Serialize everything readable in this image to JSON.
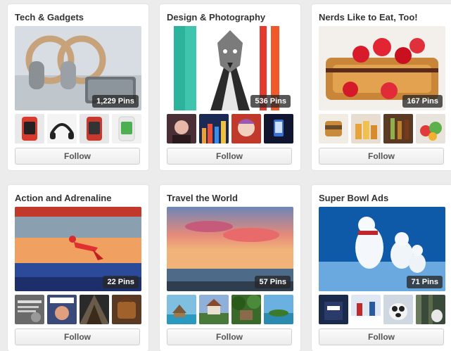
{
  "boards": [
    {
      "title": "Tech & Gadgets",
      "cover_label": "headphones-and-speaker-cover",
      "pin_count": "1,229 Pins",
      "follow_label": "Follow",
      "thumbs": [
        "smartwatch-red",
        "headphones-black",
        "smartwatch-green",
        "smartwatch-white"
      ]
    },
    {
      "title": "Design & Photography",
      "cover_label": "wolf-in-suit-illustration-cover",
      "pin_count": "536 Pins",
      "follow_label": "Follow",
      "thumbs": [
        "portrait-dark",
        "city-skyline-night",
        "woman-portrait-red",
        "hand-holding-phone"
      ]
    },
    {
      "title": "Nerds Like to Eat, Too!",
      "cover_label": "french-toast-strawberries-cover",
      "pin_count": "167 Pins",
      "follow_label": "Follow",
      "thumbs": [
        "food-tin",
        "drinks-glasses",
        "beer-bottles",
        "fruit-plate"
      ]
    },
    {
      "title": "Action and Adrenaline",
      "cover_label": "speed-skater-cover",
      "pin_count": "22 Pins",
      "follow_label": "Follow",
      "thumbs": [
        "quote-poster",
        "magazine-cover",
        "abstract-pattern",
        "leather-bag"
      ]
    },
    {
      "title": "Travel the World",
      "cover_label": "sunset-beach-cover",
      "pin_count": "57 Pins",
      "follow_label": "Follow",
      "thumbs": [
        "overwater-bungalow",
        "house-on-hill",
        "jungle-cabin",
        "tropical-island"
      ]
    },
    {
      "title": "Super Bowl Ads",
      "cover_label": "polar-bears-cover",
      "pin_count": "71 Pins",
      "follow_label": "Follow",
      "thumbs": [
        "usa-shirt",
        "snow-scene",
        "puppy",
        "bear-forest"
      ]
    }
  ]
}
